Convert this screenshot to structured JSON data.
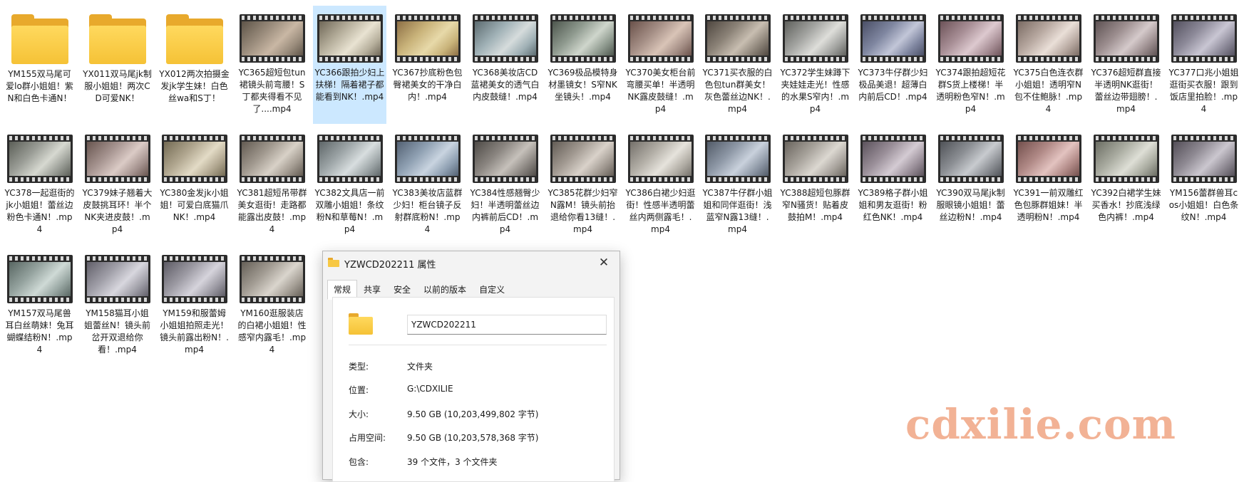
{
  "items": [
    {
      "kind": "folder",
      "label": "YM155双马尾可爱lo群小姐姐！紫N和白色卡通N！"
    },
    {
      "kind": "folder",
      "label": "YX011双马尾jk制服小姐姐！两次CD可爱NK！"
    },
    {
      "kind": "folder",
      "label": "YX012两次拍摄金发jk学生妹！白色丝wa和S丁！"
    },
    {
      "kind": "video",
      "label": "YC365超短包tun裙镜头前弯腰！S丁都夹得看不见了....mp4",
      "colors": [
        "#9a8c7c",
        "#c9b7a4",
        "#5e5448"
      ]
    },
    {
      "kind": "video",
      "label": "YC366跟拍少妇上扶梯！隔着裙子都能看到NK！.mp4",
      "selected": true,
      "colors": [
        "#b8b19e",
        "#e9e3d2",
        "#6f6757"
      ]
    },
    {
      "kind": "video",
      "label": "YC367抄底粉色包臀裙美女的干净白内！.mp4",
      "colors": [
        "#c9b37a",
        "#e7d9a9",
        "#8d6f45"
      ]
    },
    {
      "kind": "video",
      "label": "YC368美妆店CD蓝裙美女的透气白内皮鼓缝！.mp4",
      "colors": [
        "#9fb0b5",
        "#d6dcdc",
        "#5c6b70"
      ]
    },
    {
      "kind": "video",
      "label": "YC369极品模特身材墨镜女！S窄NK坐镜头！.mp4",
      "colors": [
        "#8f9a8f",
        "#cfd6cc",
        "#4d564d"
      ]
    },
    {
      "kind": "video",
      "label": "YC370美女柜台前弯腰买单！半透明NK露皮鼓缝！.mp4",
      "colors": [
        "#a58f86",
        "#d9c4b7",
        "#6a514a"
      ]
    },
    {
      "kind": "video",
      "label": "YC371买衣服的白色包tun群美女！灰色蕾丝边NK！.mp4",
      "colors": [
        "#8b8277",
        "#c8beb1",
        "#4f4740"
      ]
    },
    {
      "kind": "video",
      "label": "YC372学生妹蹲下夹娃娃走光！性感的水果S窄内！.mp4",
      "colors": [
        "#a2a3a0",
        "#dededa",
        "#5f605c"
      ]
    },
    {
      "kind": "video",
      "label": "YC373牛仔群少妇极品美退！超薄白内前后CD！.mp4",
      "colors": [
        "#7f86a0",
        "#c2c6d8",
        "#4a4f66"
      ]
    },
    {
      "kind": "video",
      "label": "YC374跟拍超短花群S货上楼梯！半透明粉色窄N！.mp4",
      "colors": [
        "#a88f96",
        "#ddc9cf",
        "#6c5258"
      ]
    },
    {
      "kind": "video",
      "label": "YC375白色连衣群小姐姐！透明窄N包不住鲍脉！.mp4",
      "colors": [
        "#b7a8a0",
        "#eadfd8",
        "#7a6b63"
      ]
    },
    {
      "kind": "video",
      "label": "YC376超短群直接半透明NK逛街！蕾丝边带翅膀！.mp4",
      "colors": [
        "#9c8e8f",
        "#d5cacb",
        "#5e5253"
      ]
    },
    {
      "kind": "video",
      "label": "YC377口兆小姐姐逛街买衣服！跟到饭店里拍脸！.mp4",
      "colors": [
        "#8d8a99",
        "#c9c6d3",
        "#53505e"
      ]
    },
    {
      "kind": "video",
      "label": "YC378一起逛街的jk小姐姐！蕾丝边粉色卡通N！.mp4",
      "colors": [
        "#9a9d96",
        "#d7d9d1",
        "#5b5e57"
      ]
    },
    {
      "kind": "video",
      "label": "YC379妹子翘着大皮鼓挑耳环！半个NK夹进皮鼓！.mp4",
      "colors": [
        "#a69490",
        "#dbcbc6",
        "#68554f"
      ]
    },
    {
      "kind": "video",
      "label": "YC380金发jk小姐姐！可爱白底猫爪NK！.mp4",
      "colors": [
        "#b0a68f",
        "#e3dbc6",
        "#736a53"
      ]
    },
    {
      "kind": "video",
      "label": "YC381超短吊带群美女逛街！走路都能露出皮鼓！.mp4",
      "colors": [
        "#a1998f",
        "#d8d1c7",
        "#625a51"
      ]
    },
    {
      "kind": "video",
      "label": "YC382文具店一前双雕小姐姐！条纹粉N和草莓N！.mp4",
      "colors": [
        "#9ea6a8",
        "#d8dedf",
        "#5e6668"
      ]
    },
    {
      "kind": "video",
      "label": "YC383美妆店蓝群少妇！柜台镜子反射群底粉N！.mp4",
      "colors": [
        "#8fa0b2",
        "#c9d4e0",
        "#536173"
      ]
    },
    {
      "kind": "video",
      "label": "YC384性感翘臀少妇！半透明蕾丝边内裤前后CD！.mp4",
      "colors": [
        "#8a8580",
        "#c6c1bb",
        "#4e4a46"
      ]
    },
    {
      "kind": "video",
      "label": "YC385花群少妇窄N露M！镜头前抬退给你看13缝！.mp4",
      "colors": [
        "#a29a92",
        "#d9d2ca",
        "#635c55"
      ]
    },
    {
      "kind": "video",
      "label": "YC386白裙少妇逛街！性感半透明蕾丝内两侧露毛！.mp4",
      "colors": [
        "#b2aea6",
        "#e6e3dc",
        "#74706a"
      ]
    },
    {
      "kind": "video",
      "label": "YC387牛仔群小姐姐和同伴逛街！浅蓝窄N露13缝！.mp4",
      "colors": [
        "#8e98a6",
        "#c9d1dc",
        "#525b68"
      ]
    },
    {
      "kind": "video",
      "label": "YC388超短包豚群窄N骚货！贴着皮鼓拍M！.mp4",
      "colors": [
        "#a7a29b",
        "#dcd8d1",
        "#69645d"
      ]
    },
    {
      "kind": "video",
      "label": "YC389格子群小姐姐和男友逛街！粉红色NK！.mp4",
      "colors": [
        "#9a8f99",
        "#d4cbd3",
        "#5b525b"
      ]
    },
    {
      "kind": "video",
      "label": "YC390双马尾jk制服眼镜小姐姐！蕾丝边粉N！.mp4",
      "colors": [
        "#8b8e93",
        "#c8cbcf",
        "#4f5257"
      ]
    },
    {
      "kind": "video",
      "label": "YC391一前双雕红色包豚群姐妹！半透明粉N！.mp4",
      "colors": [
        "#b08986",
        "#e3c3c0",
        "#73504d"
      ]
    },
    {
      "kind": "video",
      "label": "YC392白裙学生妹买香水！抄底浅绿色内裤！.mp4",
      "colors": [
        "#a9aba0",
        "#dedfd6",
        "#6b6d63"
      ]
    },
    {
      "kind": "video",
      "label": "YM156蕾群兽耳cos小姐姐！白色条纹N！.mp4",
      "colors": [
        "#8f8a93",
        "#cbc7cf",
        "#534e57"
      ]
    },
    {
      "kind": "video",
      "label": "YM157双马尾兽耳白丝萌妹！兔耳蝴蝶结粉N！.mp4",
      "colors": [
        "#95a39f",
        "#cfdad6",
        "#586662"
      ]
    },
    {
      "kind": "video",
      "label": "YM158猫耳小姐姐蕾丝N！镜头前岔开双退给你看！.mp4",
      "colors": [
        "#a09fa8",
        "#d8d7de",
        "#615f69"
      ]
    },
    {
      "kind": "video",
      "label": "YM159和服蕾姆小姐姐拍照走光！镜头前露出粉N！.mp4",
      "colors": [
        "#9c9aa3",
        "#d6d4dc",
        "#5d5b64"
      ]
    },
    {
      "kind": "video",
      "label": "YM160逛服装店的白裙小姐姐！性感窄内露毛！.mp4",
      "colors": [
        "#a39d94",
        "#dad5cd",
        "#655f57"
      ]
    }
  ],
  "dialog": {
    "title": "YZWCD202211 属性",
    "close_label": "✕",
    "tabs": [
      "常规",
      "共享",
      "安全",
      "以前的版本",
      "自定义"
    ],
    "active_tab": 0,
    "folder_name": "YZWCD202211",
    "props": [
      {
        "key": "类型:",
        "value": "文件夹"
      },
      {
        "key": "位置:",
        "value": "G:\\CDXILIE"
      },
      {
        "key": "大小:",
        "value": "9.50 GB (10,203,499,802 字节)"
      },
      {
        "key": "占用空间:",
        "value": "9.50 GB (10,203,578,368 字节)"
      },
      {
        "key": "包含:",
        "value": "39 个文件，3 个文件夹"
      }
    ]
  },
  "watermark": "cdxilie.com"
}
